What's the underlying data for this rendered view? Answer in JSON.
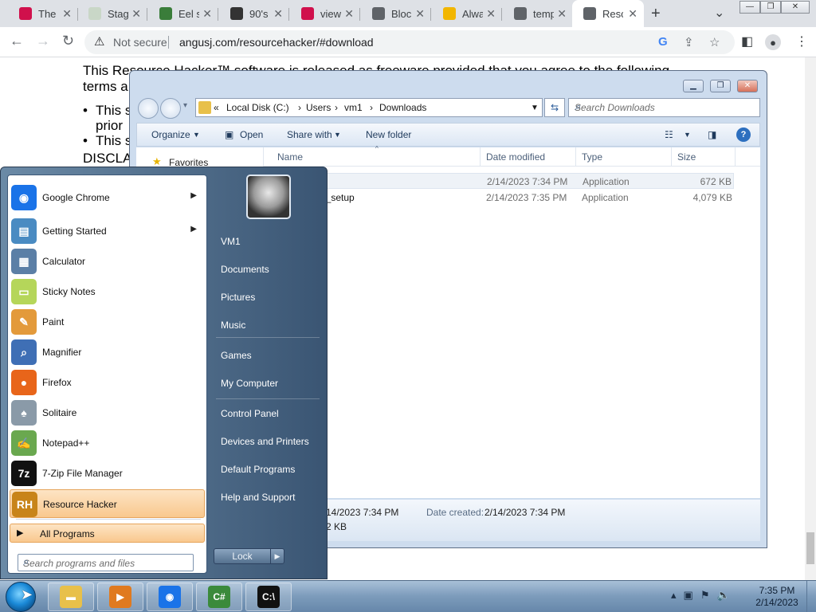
{
  "browser": {
    "tabs": [
      {
        "title": "The",
        "fav_color": "#d0104c",
        "fav_text": ""
      },
      {
        "title": "Stag",
        "fav_color": "#c9d7c7",
        "fav_text": ""
      },
      {
        "title": "Eel s",
        "fav_color": "#3a7d3a",
        "fav_text": ""
      },
      {
        "title": "90's",
        "fav_color": "#333333",
        "fav_text": ""
      },
      {
        "title": "view",
        "fav_color": "#d0104c",
        "fav_text": ""
      },
      {
        "title": "Bloc",
        "fav_color": "#5f6368",
        "fav_text": ""
      },
      {
        "title": "Alwa",
        "fav_color": "#f2b600",
        "fav_text": ""
      },
      {
        "title": "temp",
        "fav_color": "#5f6368",
        "fav_text": ""
      },
      {
        "title": "Reso",
        "fav_color": "#5f6368",
        "fav_text": ""
      }
    ],
    "security_label": "Not secure",
    "url": "angusj.com/resourcehacker/#download"
  },
  "page": {
    "line1": "This Resource Hacker™ software is released as freeware provided that you agree to the following",
    "line2": "terms a",
    "bullet1a": "This s",
    "bullet1b": "prior",
    "bullet2": "This s",
    "line3": "DISCLA"
  },
  "explorer": {
    "breadcrumb": [
      "«",
      "Local Disk (C:)",
      "Users",
      "vm1",
      "Downloads"
    ],
    "search_placeholder": "Search Downloads",
    "commands": {
      "organize": "Organize",
      "open": "Open",
      "share": "Share with",
      "new_folder": "New folder"
    },
    "nav_favorites": "Favorites",
    "columns": {
      "name": "Name",
      "date": "Date modified",
      "type": "Type",
      "size": "Size"
    },
    "files": [
      {
        "name": "",
        "date": "2/14/2023 7:34 PM",
        "type": "Application",
        "size": "672 KB"
      },
      {
        "name": "er_setup",
        "date": "2/14/2023 7:35 PM",
        "type": "Application",
        "size": "4,079 KB"
      }
    ],
    "details": {
      "modified_value": "14/2023 7:34 PM",
      "created_label": "Date created:",
      "created_value": "2/14/2023 7:34 PM",
      "size_value": "2 KB"
    }
  },
  "start_menu": {
    "programs": [
      {
        "label": "Google Chrome",
        "icon": "chrome-icon",
        "color": "#1a73e8",
        "glyph": "◉",
        "arrow": true
      },
      {
        "label": "Getting Started",
        "icon": "getting-started-icon",
        "color": "#4a8bc2",
        "glyph": "▤",
        "arrow": true
      },
      {
        "label": "Calculator",
        "icon": "calculator-icon",
        "color": "#5b7fa6",
        "glyph": "▦",
        "arrow": false
      },
      {
        "label": "Sticky Notes",
        "icon": "sticky-notes-icon",
        "color": "#b5d65a",
        "glyph": "▭",
        "arrow": false
      },
      {
        "label": "Paint",
        "icon": "paint-icon",
        "color": "#e39a3b",
        "glyph": "✎",
        "arrow": false
      },
      {
        "label": "Magnifier",
        "icon": "magnifier-icon",
        "color": "#3f6fb5",
        "glyph": "⌕",
        "arrow": false
      },
      {
        "label": "Firefox",
        "icon": "firefox-icon",
        "color": "#e8651a",
        "glyph": "●",
        "arrow": false
      },
      {
        "label": "Solitaire",
        "icon": "solitaire-icon",
        "color": "#8a9aa8",
        "glyph": "♠",
        "arrow": false
      },
      {
        "label": "Notepad++",
        "icon": "notepad-plus-plus-icon",
        "color": "#6aa84f",
        "glyph": "✍",
        "arrow": false
      },
      {
        "label": "7-Zip File Manager",
        "icon": "7zip-icon",
        "color": "#111111",
        "glyph": "7z",
        "arrow": false
      },
      {
        "label": "Resource Hacker",
        "icon": "resource-hacker-icon",
        "color": "#c8841a",
        "glyph": "RH",
        "arrow": false
      }
    ],
    "all_programs": "All Programs",
    "search_placeholder": "Search programs and files",
    "right_links": [
      "VM1",
      "Documents",
      "Pictures",
      "Music",
      "Games",
      "My Computer",
      "Control Panel",
      "Devices and Printers",
      "Default Programs",
      "Help and Support"
    ],
    "lock_label": "Lock"
  },
  "taskbar": {
    "time": "7:35 PM",
    "date": "2/14/2023",
    "apps": [
      {
        "name": "explorer",
        "icon": "folder-icon",
        "color": "#e8c04a",
        "glyph": "▬"
      },
      {
        "name": "media-player",
        "icon": "media-player-icon",
        "color": "#e07a1f",
        "glyph": "▶"
      },
      {
        "name": "chrome",
        "icon": "chrome-icon",
        "color": "#1a73e8",
        "glyph": "◉"
      },
      {
        "name": "csharp",
        "icon": "csharp-icon",
        "color": "#3b8a3b",
        "glyph": "C#"
      },
      {
        "name": "cmd",
        "icon": "command-prompt-icon",
        "color": "#111111",
        "glyph": "C:\\"
      }
    ]
  }
}
